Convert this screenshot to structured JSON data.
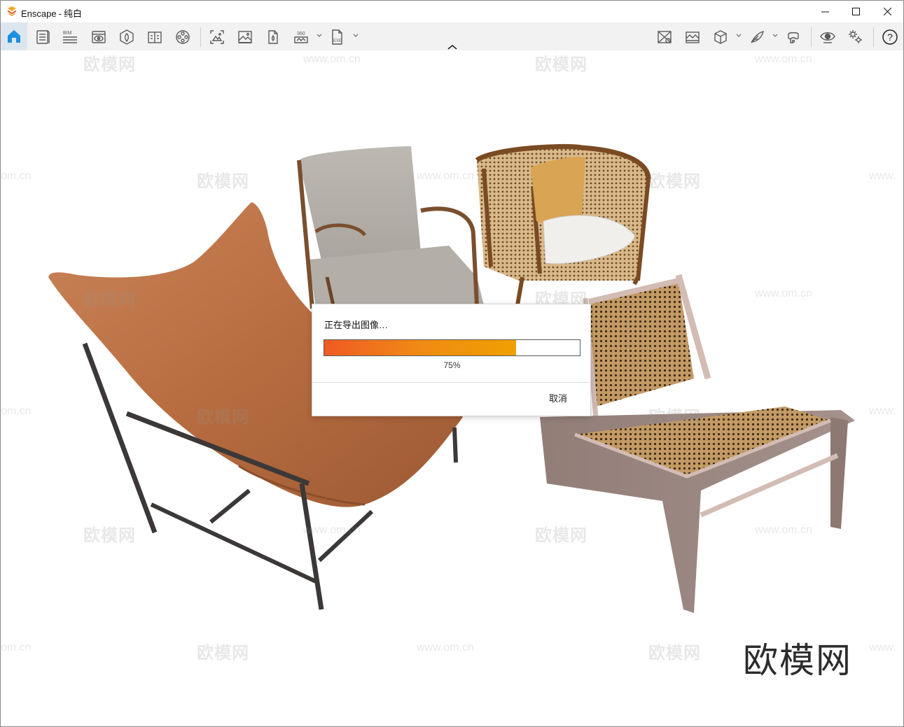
{
  "window": {
    "app_name": "Enscape",
    "title_separator": "-",
    "scene_name": "纯白"
  },
  "toolbar": {
    "left_icons": [
      "home-icon",
      "file-list-icon",
      "bim-icon",
      "view-icon",
      "asset-library-icon",
      "panorama-book-icon",
      "video-reel-icon",
      "screenshot-icon",
      "image-export-icon",
      "batch-render-icon",
      "panorama-360-icon",
      "exe-export-icon"
    ],
    "bim_label": "BIM",
    "panorama_label": "360",
    "exe_label": "EXE",
    "right_icons": [
      "collaborative-annotation-icon",
      "material-editor-icon",
      "cube-view-icon",
      "feather-icon",
      "vr-headset-icon",
      "visibility-icon",
      "settings-icon",
      "help-icon"
    ],
    "help_label": "?"
  },
  "viewport": {
    "watermark_text": "欧模网",
    "watermark_url": "www.om.cn",
    "watermark_url_partial_left": "om.cn",
    "watermark_url_partial_right": "www.",
    "brand_watermark": "欧模网"
  },
  "dialog": {
    "title": "正在导出图像…",
    "progress_value": 0.75,
    "progress_text": "75%",
    "cancel_label": "取消"
  },
  "colors": {
    "progress_start": "#ef5a24",
    "progress_end": "#f0a000",
    "home_active_bg": "#dde6f0",
    "icon_color": "#5a5a5a",
    "home_icon_color": "#1e90e0"
  }
}
